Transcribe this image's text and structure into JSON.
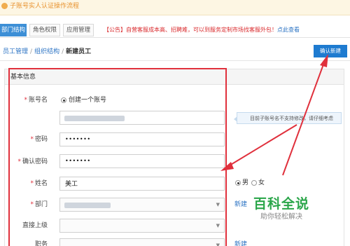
{
  "notice": {
    "text": "子账号实人认证操作流程"
  },
  "tabs": [
    {
      "label": "部门结构",
      "active": true
    },
    {
      "label": "角色权限",
      "active": false
    },
    {
      "label": "应用管理",
      "active": false
    }
  ],
  "announcement": {
    "tag": "【公告】",
    "body": "自营客服成本高、招聘难，可以到服务定制市场找客服外包！",
    "link": "点此查看"
  },
  "breadcrumb": {
    "item1": "员工管理",
    "item2": "组织结构",
    "current": "新建员工"
  },
  "confirm_button": "确认新建",
  "panel_title": "基本信息",
  "form": {
    "account": {
      "label": "账号名",
      "option": "创建一个账号"
    },
    "tip": "目前子账号名不支持修改，请仔细考虑",
    "password": {
      "label": "密码",
      "value": "•••••••"
    },
    "confirm_password": {
      "label": "确认密码",
      "value": "•••••••"
    },
    "name": {
      "label": "姓名",
      "value": "美工"
    },
    "gender": {
      "male": "男",
      "female": "女",
      "selected": "male"
    },
    "department": {
      "label": "部门"
    },
    "new_link": "新建",
    "supervisor": {
      "label": "直接上级"
    },
    "position": {
      "label": "职务"
    }
  },
  "watermark": {
    "title": "百科全说",
    "subtitle": "助你轻松解决"
  },
  "colors": {
    "accent": "#1e7bd0",
    "highlight": "#e0303c",
    "notice": "#e8922e",
    "watermark": "#2ba64a"
  }
}
